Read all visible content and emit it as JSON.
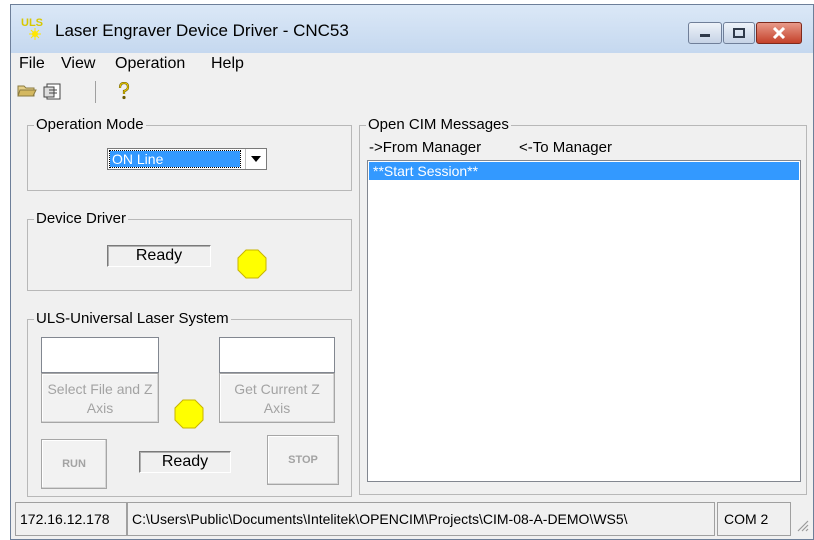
{
  "window": {
    "title": "Laser Engraver Device Driver - CNC53",
    "logo_text": "ULS"
  },
  "menu": [
    "File",
    "View",
    "Operation",
    "Help"
  ],
  "toolbar": {
    "icons": [
      "open-folder-icon",
      "properties-icon",
      "help-icon"
    ]
  },
  "operation_mode": {
    "legend": "Operation Mode",
    "selected": "ON Line"
  },
  "device_driver": {
    "legend": "Device Driver",
    "status": "Ready",
    "led_color": "#ffff00"
  },
  "uls": {
    "legend": "ULS-Universal Laser System",
    "select_file_label": "Select File and Z Axis",
    "get_current_label": "Get Current Z Axis",
    "run_label": "RUN",
    "stop_label": "STOP",
    "status": "Ready",
    "led_color": "#ffff00"
  },
  "cim": {
    "legend": "Open CIM Messages",
    "from_manager": "->From Manager",
    "to_manager": "<-To Manager",
    "messages": [
      "**Start Session**"
    ]
  },
  "statusbar": {
    "ip": "172.16.12.178",
    "path": "C:\\Users\\Public\\Documents\\Intelitek\\OPENCIM\\Projects\\CIM-08-A-DEMO\\WS5\\",
    "port": "COM 2"
  },
  "colors": {
    "selection": "#3399ff",
    "led": "#ffff00",
    "close_button": "#c4412a"
  }
}
